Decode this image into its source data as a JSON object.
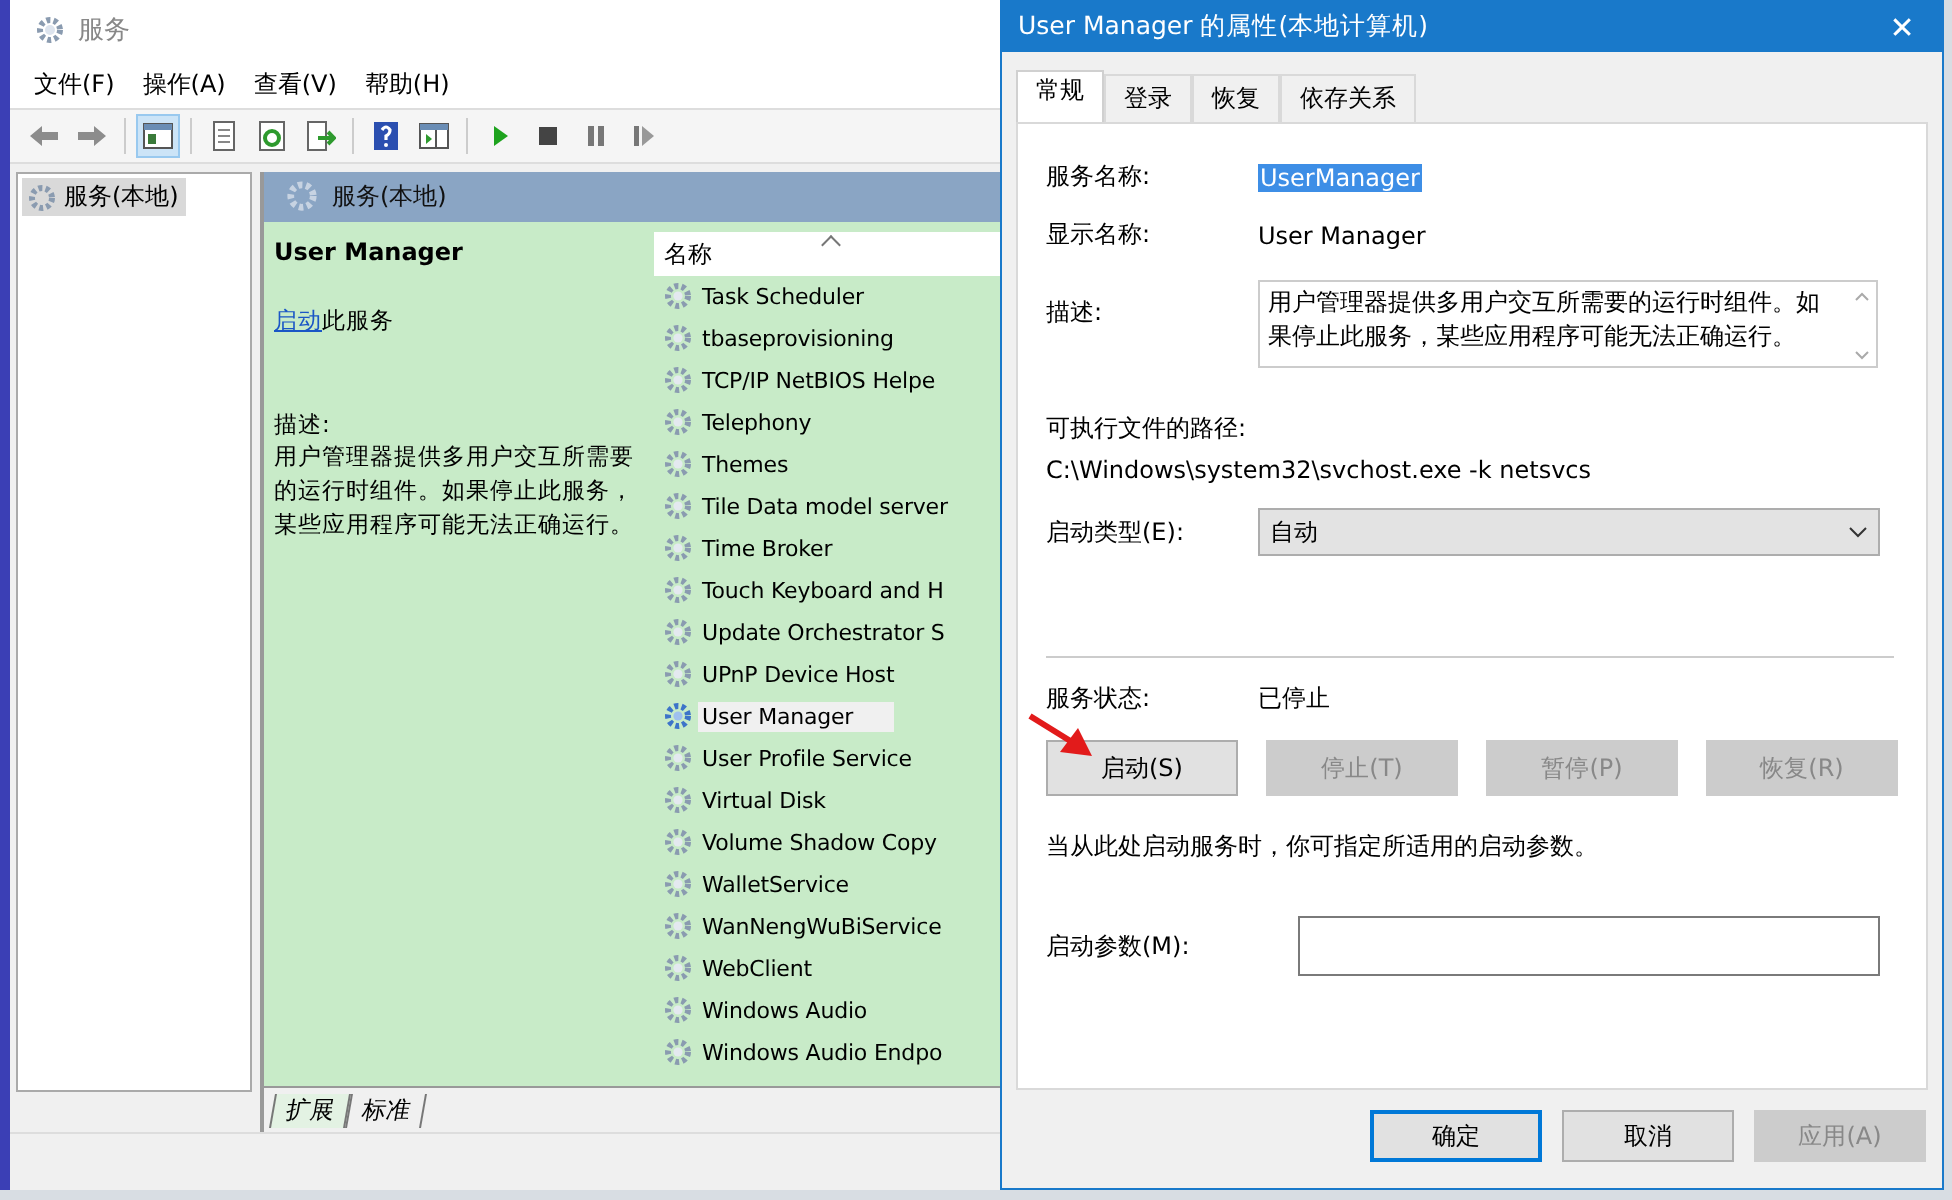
{
  "services_window": {
    "title": "服务",
    "menu": [
      "文件(F)",
      "操作(A)",
      "查看(V)",
      "帮助(H)"
    ],
    "toolbar": [
      {
        "kind": "back",
        "pressed": false
      },
      {
        "kind": "forward",
        "pressed": false
      },
      {
        "kind": "tree",
        "pressed": true
      },
      {
        "kind": "properties",
        "pressed": false
      },
      {
        "kind": "refresh",
        "pressed": false
      },
      {
        "kind": "export",
        "pressed": false
      },
      {
        "kind": "help",
        "pressed": false
      },
      {
        "kind": "view",
        "pressed": false
      },
      {
        "kind": "start",
        "pressed": false
      },
      {
        "kind": "stop",
        "pressed": false
      },
      {
        "kind": "pause",
        "pressed": false
      },
      {
        "kind": "resume",
        "pressed": false
      }
    ],
    "tree": [
      {
        "label": "服务(本地)",
        "selected": true
      }
    ],
    "header": "服务(本地)",
    "detail": {
      "name": "User Manager",
      "action_link": "启动",
      "action_text": "此服务",
      "description_label": "描述:",
      "description": "用户管理器提供多用户交互所需要的运行时组件。如果停止此服务，某些应用程序可能无法正确运行。"
    },
    "list": {
      "column": "名称",
      "rows": [
        {
          "name": "Task Scheduler",
          "selected": false
        },
        {
          "name": "tbaseprovisioning",
          "selected": false
        },
        {
          "name": "TCP/IP NetBIOS Helpe",
          "selected": false
        },
        {
          "name": "Telephony",
          "selected": false
        },
        {
          "name": "Themes",
          "selected": false
        },
        {
          "name": "Tile Data model server",
          "selected": false
        },
        {
          "name": "Time Broker",
          "selected": false
        },
        {
          "name": "Touch Keyboard and H",
          "selected": false
        },
        {
          "name": "Update Orchestrator S",
          "selected": false
        },
        {
          "name": "UPnP Device Host",
          "selected": false
        },
        {
          "name": "User Manager",
          "selected": true
        },
        {
          "name": "User Profile Service",
          "selected": false
        },
        {
          "name": "Virtual Disk",
          "selected": false
        },
        {
          "name": "Volume Shadow Copy",
          "selected": false
        },
        {
          "name": "WalletService",
          "selected": false
        },
        {
          "name": "WanNengWuBiService",
          "selected": false
        },
        {
          "name": "WebClient",
          "selected": false
        },
        {
          "name": "Windows Audio",
          "selected": false
        },
        {
          "name": "Windows Audio Endpo",
          "selected": false
        }
      ]
    },
    "view_tabs": [
      {
        "label": "扩展",
        "selected": true
      },
      {
        "label": "标准",
        "selected": false
      }
    ]
  },
  "dialog": {
    "title": "User Manager 的属性(本地计算机)",
    "close": "✕",
    "tabs": [
      {
        "label": "常规",
        "selected": true
      },
      {
        "label": "登录",
        "selected": false
      },
      {
        "label": "恢复",
        "selected": false
      },
      {
        "label": "依存关系",
        "selected": false
      }
    ],
    "service_name_label": "服务名称:",
    "service_name": "UserManager",
    "display_name_label": "显示名称:",
    "display_name": "User Manager",
    "description_label": "描述:",
    "description": "用户管理器提供多用户交互所需要的运行时组件。如果停止此服务，某些应用程序可能无法正确运行。",
    "path_label": "可执行文件的路径:",
    "path": "C:\\Windows\\system32\\svchost.exe -k netsvcs",
    "startup_type_label": "启动类型(E):",
    "startup_type": "自动",
    "status_label": "服务状态:",
    "status": "已停止",
    "service_buttons": [
      {
        "label": "启动(S)",
        "disabled": false
      },
      {
        "label": "停止(T)",
        "disabled": true
      },
      {
        "label": "暂停(P)",
        "disabled": true
      },
      {
        "label": "恢复(R)",
        "disabled": true
      }
    ],
    "hint": "当从此处启动服务时，你可指定所适用的启动参数。",
    "params_label": "启动参数(M):",
    "buttons": [
      {
        "label": "确定",
        "default": true,
        "disabled": false
      },
      {
        "label": "取消",
        "default": false,
        "disabled": false
      },
      {
        "label": "应用(A)",
        "default": false,
        "disabled": true
      }
    ]
  }
}
